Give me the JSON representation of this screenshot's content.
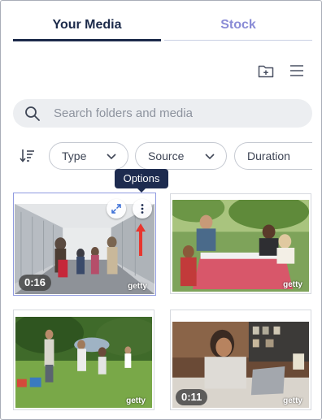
{
  "tabs": [
    {
      "label": "Your Media",
      "active": true
    },
    {
      "label": "Stock",
      "active": false
    }
  ],
  "toolbar": {
    "new_folder_icon": "folder-plus-icon",
    "menu_icon": "hamburger-menu-icon"
  },
  "search": {
    "placeholder": "Search folders and media",
    "value": ""
  },
  "filters": {
    "sort_icon": "sort-descending-icon",
    "chips": [
      {
        "label": "Type"
      },
      {
        "label": "Source"
      },
      {
        "label": "Duration"
      }
    ]
  },
  "tooltip": {
    "label": "Options"
  },
  "media": [
    {
      "subject": "family walking through airport with luggage",
      "source_mark": "getty",
      "duration": "0:16",
      "selected": true
    },
    {
      "subject": "family eating at outdoor picnic table",
      "source_mark": "getty",
      "duration": "",
      "selected": false
    },
    {
      "subject": "family playing in park with blanket",
      "source_mark": "getty",
      "duration": "",
      "selected": false
    },
    {
      "subject": "woman working on laptop in cafe",
      "source_mark": "getty",
      "duration": "0:11",
      "selected": false
    }
  ],
  "colors": {
    "primary_text": "#1c2a4a",
    "stock_tab": "#8a8cd6",
    "tooltip_bg": "#1d2b4f",
    "selected_border": "#8f9ae0",
    "annotation_arrow": "#e8362e"
  }
}
